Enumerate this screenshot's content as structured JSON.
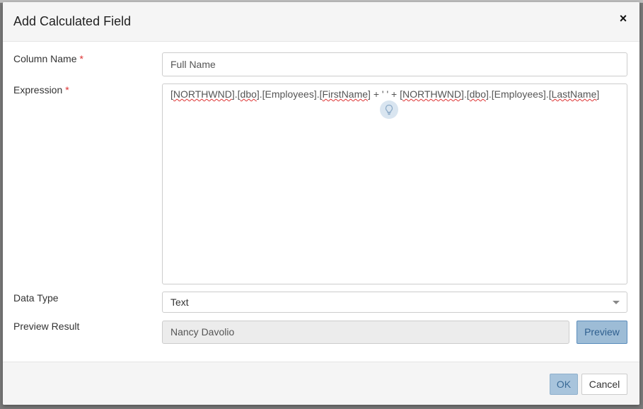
{
  "dialog": {
    "title": "Add Calculated Field",
    "close_symbol": "×"
  },
  "fields": {
    "column_name": {
      "label": "Column Name",
      "required_mark": "*",
      "value": "Full Name"
    },
    "expression": {
      "label": "Expression",
      "required_mark": "*",
      "tokens": [
        {
          "text": "[",
          "flag": false
        },
        {
          "text": "NORTHWND",
          "flag": true
        },
        {
          "text": "].[",
          "flag": false
        },
        {
          "text": "dbo",
          "flag": true
        },
        {
          "text": "].[Employees].[",
          "flag": false
        },
        {
          "text": "FirstName",
          "flag": true
        },
        {
          "text": "] + ' ' + [",
          "flag": false
        },
        {
          "text": "NORTHWND",
          "flag": true
        },
        {
          "text": "].[",
          "flag": false
        },
        {
          "text": "dbo",
          "flag": true
        },
        {
          "text": "].[Employees].[",
          "flag": false
        },
        {
          "text": "LastName",
          "flag": true
        },
        {
          "text": "]",
          "flag": false
        }
      ],
      "hint_icon": "lightbulb-icon"
    },
    "data_type": {
      "label": "Data Type",
      "value": "Text"
    },
    "preview_result": {
      "label": "Preview Result",
      "value": "Nancy Davolio",
      "button_label": "Preview"
    }
  },
  "footer": {
    "ok_label": "OK",
    "cancel_label": "Cancel"
  },
  "colors": {
    "required": "#dd3333",
    "primary_button": "#a8c4dc",
    "preview_button": "#9dbcd6"
  }
}
